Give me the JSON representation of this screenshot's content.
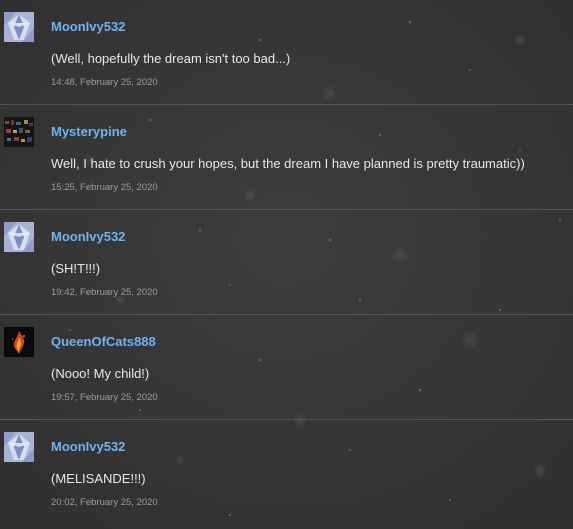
{
  "colors": {
    "background": "#373737",
    "author": "#6fb3ef",
    "text": "#e8e8e8",
    "timestamp": "#9c9c9c",
    "divider": "#555555"
  },
  "comments": [
    {
      "author": "MoonIvy532",
      "avatar": "crystal-avatar-icon",
      "text": "(Well, hopefully the dream isn't too bad...)",
      "timestamp": "14:48, February 25, 2020"
    },
    {
      "author": "Mysterypine",
      "avatar": "city-lights-avatar-icon",
      "text": "Well, I hate to crush your hopes, but the dream I have planned is pretty traumatic))",
      "timestamp": "15:25, February 25, 2020"
    },
    {
      "author": "MoonIvy532",
      "avatar": "crystal-avatar-icon",
      "text": "(SH!T!!!)",
      "timestamp": "19:42, February 25, 2020"
    },
    {
      "author": "QueenOfCats888",
      "avatar": "flame-avatar-icon",
      "text": "(Nooo! My child!)",
      "timestamp": "19:57, February 25, 2020"
    },
    {
      "author": "MoonIvy532",
      "avatar": "crystal-avatar-icon",
      "text": "(MELISANDE!!!)",
      "timestamp": "20:02, February 25, 2020"
    }
  ]
}
